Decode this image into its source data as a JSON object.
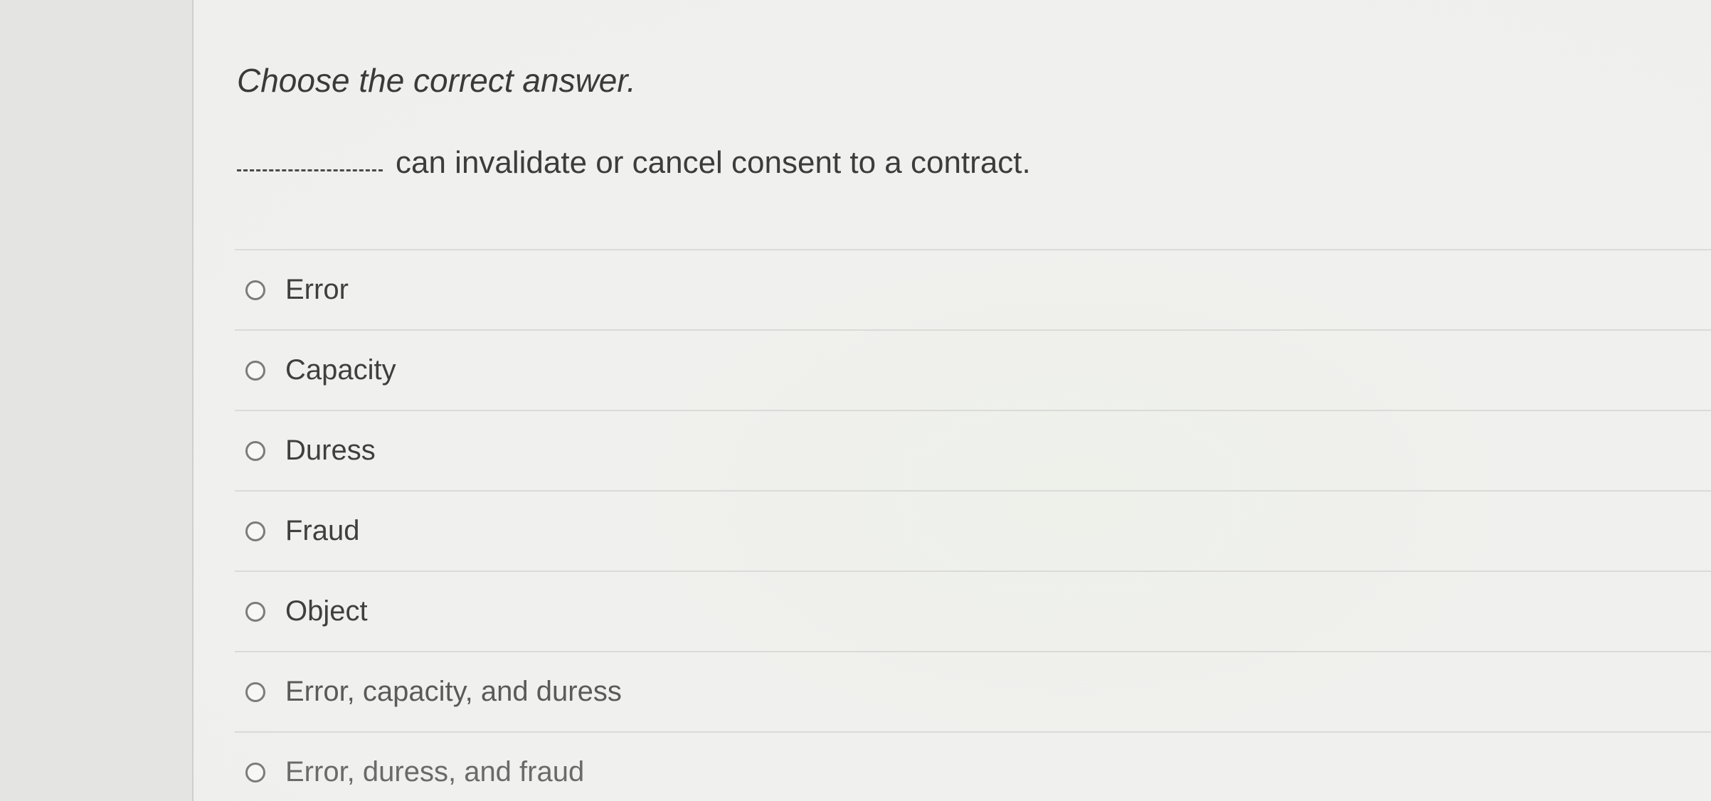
{
  "instruction": "Choose the correct answer.",
  "question": {
    "blank": "__________",
    "text": "can invalidate or cancel consent to a contract."
  },
  "options": [
    {
      "label": "Error"
    },
    {
      "label": "Capacity"
    },
    {
      "label": "Duress"
    },
    {
      "label": "Fraud"
    },
    {
      "label": "Object"
    },
    {
      "label": "Error, capacity, and duress"
    },
    {
      "label": "Error, duress, and fraud"
    }
  ],
  "colors": {
    "background": "#efefed",
    "text": "#3c3c3c",
    "radio_border": "#7a7d7a",
    "divider": "#dadbd8"
  }
}
